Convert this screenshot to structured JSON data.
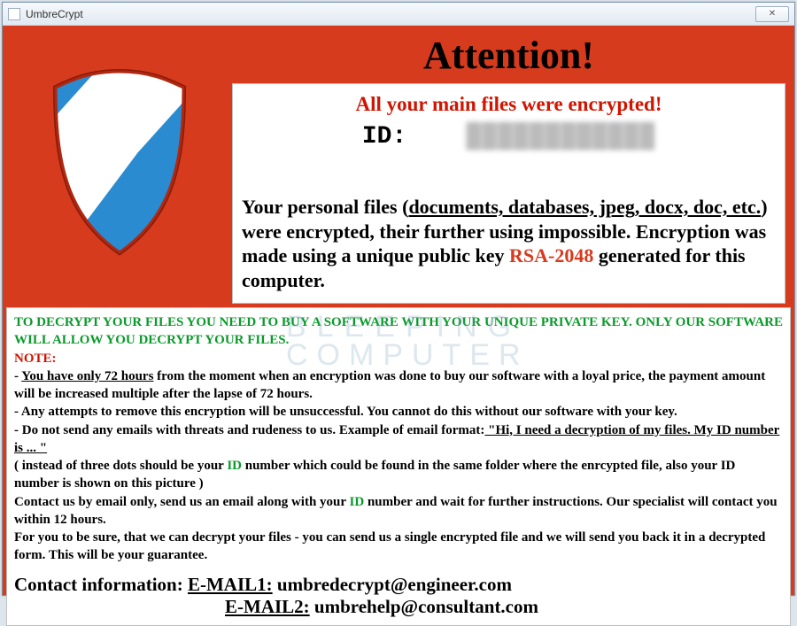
{
  "window": {
    "title": "UmbreCrypt",
    "close_glyph": "✕"
  },
  "attention": "Attention!",
  "whitepanel": {
    "heading": "All your main files were encrypted!",
    "id_label": "ID:",
    "id_value": "████████████",
    "para_a": "Your personal files (",
    "para_b_u": "documents, databases, jpeg, docx, doc, etc.",
    "para_c": ") were encrypted, their further using impossible. Encryption was made using a unique public key ",
    "rsa": "RSA-2048",
    "para_d": " generated for this computer."
  },
  "bottom": {
    "l1": "TO DECRYPT YOUR FILES YOU NEED TO BUY A SOFTWARE WITH YOUR UNIQUE PRIVATE KEY. ONLY OUR SOFTWARE WILL ALLOW YOU DECRYPT YOUR FILES.",
    "note": "NOTE:",
    "l2a": "- ",
    "l2u": "You have only 72 hours",
    "l2b": " from the moment when an encryption was done to buy our software with a loyal price, the payment amount will be increased multiple after the lapse of 72 hours.",
    "l3": "- Any attempts to remove this encryption will be unsuccessful. You cannot do this without our software with your key.",
    "l4a": "- Do not send any emails with threats and rudeness to us. Example of email format:",
    "l4u": " \"Hi, I need a decryption of my files. My ID number is ... \"",
    "l5a": "( instead of three dots should be your ",
    "l5id": "ID",
    "l5b": " number which could be found in the same folder where the enrcypted file, also your ID number is shown on this picture )",
    "l6a": "Contact us by email only, send us an email along with your ",
    "l6id": "ID",
    "l6b": " number and wait for further instructions. Our specialist will contact you within 12 hours.",
    "l7": "For you to be sure, that we can decrypt your files - you can send us a single encrypted file and we will send you back it in a decrypted form. This will be your guarantee."
  },
  "contact": {
    "label": "Contact information:",
    "e1_label": "E-MAIL1:",
    "e1": " umbredecrypt@engineer.com",
    "e2_label": "E-MAIL2:",
    "e2": " umbrehelp@consultant.com"
  },
  "watermark": {
    "a": "BLEEPING",
    "b": "COMPUTER"
  }
}
